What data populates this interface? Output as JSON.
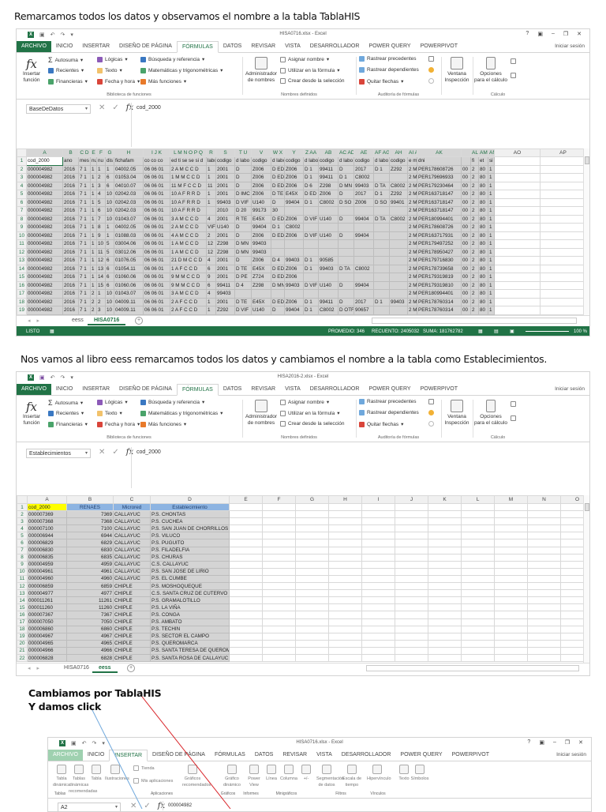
{
  "captions": {
    "step1": "Remarcamos todos los datos y observamos el nombre a la tabla TablaHIS",
    "step2": "Nos vamos al libro eess remarcamos todos los datos y cambiamos el nombre a la tabla como Establecimientos.",
    "step3_line1": "Cambiamos por TablaHIS",
    "step3_line2": "Y damos click"
  },
  "window_controls": {
    "help": "?",
    "ribbon_opts": "▣",
    "minimize": "–",
    "restore": "❐",
    "close": "✕"
  },
  "tabs": [
    "ARCHIVO",
    "INICIO",
    "INSERTAR",
    "DISEÑO DE PÁGINA",
    "FÓRMULAS",
    "DATOS",
    "REVISAR",
    "VISTA",
    "DESARROLLADOR",
    "POWER QUERY",
    "POWERPIVOT"
  ],
  "signin": "Iniciar sesión",
  "formula_icons": {
    "cancel": "✕",
    "enter": "✓",
    "fx": "fx"
  },
  "ribbon_formulas": {
    "insert_function": "Insertar función",
    "lib": [
      "Autosuma",
      "Recientes",
      "Financieras",
      "Lógicas",
      "Texto",
      "Fecha y hora",
      "Búsqueda y referencia",
      "Matemáticas y trigonométricas",
      "Más funciones"
    ],
    "lib_label": "Biblioteca de funciones",
    "name_manager": "Administrador de nombres",
    "names": [
      "Asignar nombre",
      "Utilizar en la fórmula",
      "Crear desde la selección"
    ],
    "names_label": "Nombres definidos",
    "audit": [
      "Rastrear precedentes",
      "Rastrear dependientes",
      "Quitar flechas"
    ],
    "audit_label": "Auditoría de fórmulas",
    "watch": "Ventana Inspección",
    "calc_options": "Opciones para el cálculo",
    "calc_label": "Cálculo",
    "dropdown": "▾",
    "fx_glyph": "fx",
    "sigma": "Σ"
  },
  "ribbon_insert": {
    "buttons": [
      "Tabla dinámica",
      "Tablas dinámicas recomendadas",
      "Tabla",
      "Ilustraciones",
      "Tienda",
      "Mis aplicaciones",
      "Gráficos recomendados",
      "Gráfico dinámico",
      "Power View",
      "Línea",
      "Columna",
      "+/-",
      "Segmentación de datos",
      "Escala de tiempo",
      "Hipervínculo",
      "Texto",
      "Símbolos"
    ],
    "groups": [
      "Tablas",
      "Aplicaciones",
      "Gráficos",
      "Informes",
      "Minigráficos",
      "Filtros",
      "Vínculos"
    ]
  },
  "win1": {
    "title": "HISA0716.xlsx - Excel",
    "active_tab": 4,
    "namebox": "BaseDeDatos",
    "formula": "cod_2000",
    "grid": {
      "cols": [
        "A",
        "B",
        "C D",
        "E",
        "F",
        "G",
        "H",
        "I J K",
        "L M N O P Q",
        "R",
        "S",
        "T U",
        "V",
        "W X",
        "Y",
        "Z AA",
        "AB",
        "AC AD",
        "AE",
        "AF AG",
        "AH",
        "AI AJ",
        "AK",
        "",
        "AL",
        "AM",
        "AN",
        "AO",
        "AP"
      ],
      "rows": [
        [
          "cod_2000",
          "ano",
          "mes non",
          "num",
          "nu",
          "dis",
          "fichafam",
          "co co co",
          "ed ti se se si d",
          "labo",
          "codigo",
          "d labo",
          "codigo",
          "d labo",
          "codigo",
          "d labo",
          "codigo",
          "d labo",
          "codigo",
          "d labo",
          "codigo",
          "e m",
          "dni",
          "",
          "fi",
          "et",
          "si"
        ],
        [
          "000004982",
          "2016",
          "7 1",
          "1",
          "1",
          "1",
          "04002.05",
          "06 06 01",
          "2 A M C C D",
          "1",
          "2001",
          "D",
          "Z006",
          "D ED",
          "Z006",
          "D 1",
          "99411",
          "D",
          "2017",
          "D 1",
          "Z292",
          "2 M",
          "PER178608726",
          "00",
          "2",
          "80",
          "1"
        ],
        [
          "000004982",
          "2016",
          "7 1",
          "1",
          "2",
          "6",
          "01053.04",
          "06 06 01",
          "1 M M C C D",
          "1",
          "2001",
          "D",
          "Z006",
          "D ED",
          "Z006",
          "D 1",
          "99411",
          "D 1",
          "C8002",
          "",
          "",
          "2 M",
          "PER179696933",
          "00",
          "2",
          "80",
          "1"
        ],
        [
          "000004982",
          "2016",
          "7 1",
          "1",
          "3",
          "6",
          "04010.07",
          "06 06 01",
          "11 M F C C D",
          "11",
          "2001",
          "D",
          "Z006",
          "D ED",
          "Z006",
          "D 6",
          "Z298",
          "D MN",
          "99403",
          "D TA",
          "C8002",
          "2 M",
          "PER179230464",
          "00",
          "2",
          "80",
          "1"
        ],
        [
          "000004982",
          "2016",
          "7 1",
          "1",
          "4",
          "10",
          "02042.03",
          "06 06 01",
          "10 A F R R D",
          "1",
          "2001",
          "D IMC",
          "Z006",
          "D TE",
          "E45X",
          "D ED",
          "Z006",
          "D",
          "2017",
          "D 1",
          "Z292",
          "2 M",
          "PER163718147",
          "00",
          "2",
          "80",
          "1"
        ],
        [
          "000004982",
          "2016",
          "7 1",
          "1",
          "5",
          "10",
          "02042.03",
          "06 06 01",
          "10 A F R R D",
          "1",
          "99403",
          "D VIF",
          "U140",
          "D",
          "99404",
          "D 1",
          "C8002",
          "D SO",
          "Z006",
          "D SO",
          "99401",
          "2 M",
          "PER163718147",
          "00",
          "2",
          "80",
          "1"
        ],
        [
          "000004982",
          "2016",
          "7 1",
          "1",
          "6",
          "10",
          "02042.03",
          "06 06 01",
          "10 A F R R D",
          "",
          "2010",
          "D 20",
          "99173",
          "30",
          "",
          "",
          "",
          "",
          "",
          "",
          "",
          "2 M",
          "PER163718147",
          "00",
          "2",
          "80",
          "1"
        ],
        [
          "000004982",
          "2016",
          "7 1",
          "1",
          "7",
          "10",
          "01043.07",
          "06 06 01",
          "3 A M C C D",
          "4",
          "2001",
          "R TE",
          "E45X",
          "D ED",
          "Z006",
          "D VIF",
          "U140",
          "D",
          "99404",
          "D TA",
          "C8002",
          "2 M",
          "PER180994401",
          "00",
          "2",
          "80",
          "1"
        ],
        [
          "000004982",
          "2016",
          "7 1",
          "1",
          "8",
          "1",
          "04002.05",
          "06 06 01",
          "2 A M C C D",
          "VIF",
          "U140",
          "D",
          "99404",
          "D 1",
          "C8002",
          "",
          "",
          "",
          "",
          "",
          "",
          "2 M",
          "PER178608726",
          "00",
          "2",
          "80",
          "1"
        ],
        [
          "000004982",
          "2016",
          "7 1",
          "1",
          "9",
          "1",
          "01088.03",
          "06 06 01",
          "4 A M C C D",
          "2",
          "2001",
          "D",
          "Z006",
          "D ED",
          "Z006",
          "D VIF",
          "U140",
          "D",
          "99404",
          "",
          "",
          "2 M",
          "PER163717931",
          "00",
          "2",
          "80",
          "1"
        ],
        [
          "000004982",
          "2016",
          "7 1",
          "1",
          "10",
          "5",
          "03004.06",
          "06 06 01",
          "1 A M C C D",
          "12",
          "Z298",
          "D MN",
          "99403",
          "",
          "",
          "",
          "",
          "",
          "",
          "",
          "",
          "2 M",
          "PER179497252",
          "00",
          "2",
          "80",
          "1"
        ],
        [
          "000004982",
          "2016",
          "7 1",
          "1",
          "11",
          "5",
          "03012.06",
          "06 06 01",
          "1 A M C C D",
          "12",
          "Z298",
          "D MN",
          "99403",
          "",
          "",
          "",
          "",
          "",
          "",
          "",
          "",
          "2 M",
          "PER178950427",
          "00",
          "2",
          "80",
          "1"
        ],
        [
          "000004982",
          "2016",
          "7 1",
          "1",
          "12",
          "6",
          "01076.05",
          "06 06 01",
          "21 D M C C D",
          "4",
          "2001",
          "D",
          "Z006",
          "D 4",
          "99403",
          "D 1",
          "90585",
          "",
          "",
          "",
          "",
          "2 M",
          "PER179716830",
          "00",
          "2",
          "80",
          "1"
        ],
        [
          "000004982",
          "2016",
          "7 1",
          "1",
          "13",
          "6",
          "01054.11",
          "06 06 01",
          "1 A F C C D",
          "6",
          "2001",
          "D TE",
          "E45X",
          "D ED",
          "Z006",
          "D 1",
          "99403",
          "D TA",
          "C8002",
          "",
          "",
          "2 M",
          "PER178739658",
          "00",
          "2",
          "80",
          "1"
        ],
        [
          "000004982",
          "2016",
          "7 1",
          "1",
          "14",
          "6",
          "01060.06",
          "06 06 01",
          "9 M M C C D",
          "9",
          "2001",
          "D PE",
          "Z724",
          "D ED",
          "Z006",
          "",
          "",
          "",
          "",
          "",
          "",
          "2 M",
          "PER179319819",
          "00",
          "2",
          "80",
          "1"
        ],
        [
          "000004982",
          "2016",
          "7 1",
          "1",
          "15",
          "6",
          "01060.06",
          "06 06 01",
          "9 M M C C D",
          "6",
          "99411",
          "D 4",
          "Z298",
          "D MN",
          "99403",
          "D VIF",
          "U140",
          "D",
          "99404",
          "",
          "",
          "2 M",
          "PER179319810",
          "00",
          "2",
          "80",
          "1"
        ],
        [
          "000004982",
          "2016",
          "7 1",
          "2",
          "1",
          "10",
          "01043.07",
          "06 06 01",
          "3 A M C C D",
          "4",
          "99403",
          "",
          "",
          "",
          "",
          "",
          "",
          "",
          "",
          "",
          "",
          "2 M",
          "PER180994401",
          "00",
          "2",
          "80",
          "1"
        ],
        [
          "000004982",
          "2016",
          "7 1",
          "2",
          "2",
          "10",
          "04009.11",
          "06 06 01",
          "2 A F C C D",
          "1",
          "2001",
          "D TE",
          "E45X",
          "D ED",
          "Z006",
          "D 1",
          "99411",
          "D",
          "2017",
          "D 1",
          "99403",
          "2 M",
          "PER178760314",
          "00",
          "2",
          "80",
          "1"
        ],
        [
          "000004982",
          "2016",
          "7 1",
          "2",
          "3",
          "10",
          "04009.11",
          "06 06 01",
          "2 A F C C D",
          "1",
          "Z292",
          "D VIF",
          "U140",
          "D",
          "99404",
          "D 1",
          "C8002",
          "D OTF",
          "90657",
          "",
          "",
          "2 M",
          "PER178760314",
          "00",
          "2",
          "80",
          "1"
        ]
      ]
    },
    "sheets": [
      "eess",
      "HISA0716"
    ],
    "active_sheet": 1,
    "status": {
      "ready": "LISTO",
      "promedio": "PROMEDIO: 346",
      "recuento": "RECUENTO: 2405032",
      "suma": "SUMA: 181762782",
      "zoom": "100 %"
    }
  },
  "win2": {
    "title": "HISA2016-2.xlsx - Excel",
    "active_tab": 4,
    "namebox": "Establecimientos",
    "formula": "cod_2000",
    "grid": {
      "cols": [
        "A",
        "B",
        "C",
        "D",
        "E",
        "F",
        "G",
        "H",
        "I",
        "J",
        "K",
        "L",
        "M",
        "N",
        "O"
      ],
      "rows": [
        [
          "cod_2000",
          "RENAES",
          "Microred",
          "Establecimiento"
        ],
        [
          "000007369",
          "7369",
          "CALLAYUC",
          "P.S. CHONTAS"
        ],
        [
          "000007368",
          "7368",
          "CALLAYUC",
          "P.S. CUCHEA"
        ],
        [
          "000007100",
          "7100",
          "CALLAYUC",
          "P.S. SAN JUAN DE CHORRILLOS"
        ],
        [
          "000006944",
          "6944",
          "CALLAYUC",
          "P.S. VILUCO"
        ],
        [
          "000006829",
          "6829",
          "CALLAYUC",
          "P.S. PUGUITO"
        ],
        [
          "000006830",
          "6830",
          "CALLAYUC",
          "P.S. FILADELFIA"
        ],
        [
          "000006835",
          "6835",
          "CALLAYUC",
          "P.S. CHURAS"
        ],
        [
          "000004959",
          "4959",
          "CALLAYUC",
          "C.S. CALLAYUC"
        ],
        [
          "000004961",
          "4961",
          "CALLAYUC",
          "P.S. SAN JOSE DE LIRIO"
        ],
        [
          "000004960",
          "4960",
          "CALLAYUC",
          "P.S. EL CUMBE"
        ],
        [
          "000006859",
          "6859",
          "CHIPLE",
          "P.S. MOSHOQUEQUE"
        ],
        [
          "000004977",
          "4977",
          "CHIPLE",
          "C.S. SANTA CRUZ DE CUTERVO"
        ],
        [
          "000011261",
          "11261",
          "CHIPLE",
          "P.S. GRAMALOTILLO"
        ],
        [
          "000011260",
          "11260",
          "CHIPLE",
          "P.S. LA VIÑA"
        ],
        [
          "000007367",
          "7367",
          "CHIPLE",
          "P.S. CONGA"
        ],
        [
          "000007050",
          "7050",
          "CHIPLE",
          "P.S. AMBATO"
        ],
        [
          "000006860",
          "6860",
          "CHIPLE",
          "P.S. TECHIN"
        ],
        [
          "000004967",
          "4967",
          "CHIPLE",
          "P.S. SECTOR EL CAMPO"
        ],
        [
          "000004965",
          "4965",
          "CHIPLE",
          "P.S. QUEROMARCA"
        ],
        [
          "000004966",
          "4966",
          "CHIPLE",
          "P.S. SANTA TERESA DE QUEROMARCA"
        ],
        [
          "000006828",
          "6828",
          "CHIPLE",
          "P.S. SANTA ROSA DE CALLAYUC"
        ]
      ]
    },
    "sheets": [
      "HISA0716",
      "eess"
    ],
    "active_sheet": 1
  },
  "win3": {
    "title": "HISA0716.xlsx - Excel",
    "active_tab": 2,
    "namebox": "A2",
    "formula": "000004982"
  },
  "colors": {
    "excel_green": "#217346",
    "arrow_red": "#d9262b",
    "arrow_blue": "#6fa8dc"
  }
}
